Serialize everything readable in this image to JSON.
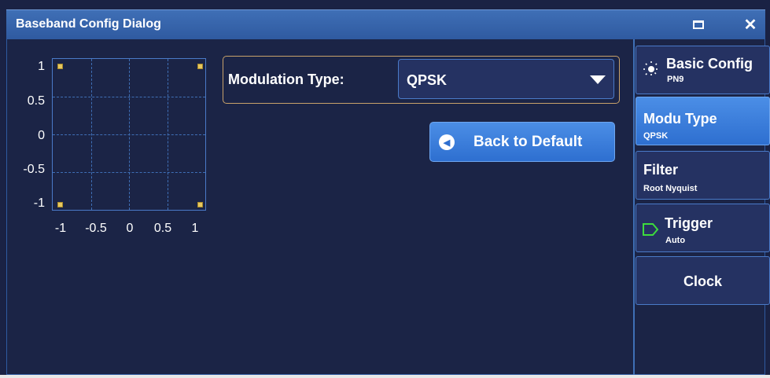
{
  "window": {
    "title": "Baseband Config Dialog",
    "maximize_icon": "maximize-icon",
    "close_label": "✕"
  },
  "constellation": {
    "y_ticks": [
      "1",
      "0.5",
      "0",
      "-0.5",
      "-1"
    ],
    "x_ticks": [
      "-1",
      "-0.5",
      "0",
      "0.5",
      "1"
    ],
    "points": [
      [
        -1,
        1
      ],
      [
        1,
        1
      ],
      [
        -1,
        -1
      ],
      [
        1,
        -1
      ]
    ],
    "point_color": "#e8c860"
  },
  "modulation": {
    "label": "Modulation Type:",
    "selected": "QPSK"
  },
  "back_button": {
    "label": "Back to Default"
  },
  "side_menu": [
    {
      "title": "Basic Config",
      "subtitle": "PN9",
      "icon": "sun-icon"
    },
    {
      "title": "Modu Type",
      "subtitle": "QPSK",
      "active": true
    },
    {
      "title": "Filter",
      "subtitle": "Root Nyquist"
    },
    {
      "title": "Trigger",
      "subtitle": "Auto",
      "icon": "trigger-icon"
    },
    {
      "title": "Clock",
      "subtitle": ""
    }
  ],
  "colors": {
    "background": "#1b2446",
    "accent": "#2e6fd0",
    "titlebar": "#3568b0",
    "group_border": "#c8a26a",
    "trigger_green": "#3ddc3d"
  }
}
